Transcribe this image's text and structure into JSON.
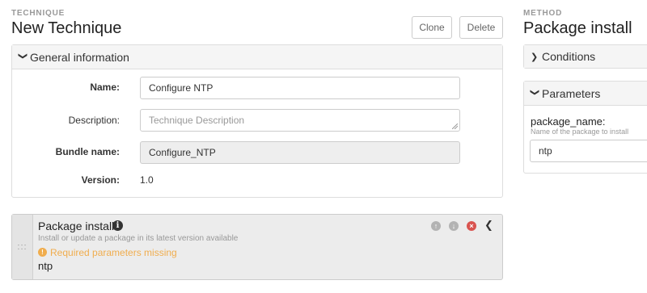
{
  "technique": {
    "eyebrow": "TECHNIQUE",
    "title": "New Technique",
    "clone_label": "Clone",
    "delete_label": "Delete"
  },
  "general_info": {
    "header": "General information",
    "name_label": "Name:",
    "name_value": "Configure NTP",
    "description_label": "Description:",
    "description_placeholder": "Technique Description",
    "bundle_label": "Bundle name:",
    "bundle_value": "Configure_NTP",
    "version_label": "Version:",
    "version_value": "1.0"
  },
  "method_block": {
    "title": "Package install",
    "description": "Install or update a package in its latest version available",
    "warning": "Required parameters missing",
    "value": "ntp",
    "handle": ":::"
  },
  "method_panel": {
    "eyebrow": "METHOD",
    "title": "Package install",
    "conditions_header": "Conditions",
    "parameters_header": "Parameters",
    "param_name": "package_name:",
    "param_help": "Name of the package to install",
    "param_value": "ntp"
  },
  "colors": {
    "warning": "#f0ad4e",
    "remove": "#d9534f",
    "move": "#b3b3b3"
  },
  "icons": {
    "expanded": "chevron-down-icon",
    "collapsed": "chevron-right-icon",
    "info": "info-circle-icon",
    "warning": "exclamation-circle-icon",
    "move_up": "arrow-up-circle-icon",
    "move_down": "arrow-down-circle-icon",
    "remove": "remove-circle-icon",
    "collapse": "chevron-left-icon"
  }
}
